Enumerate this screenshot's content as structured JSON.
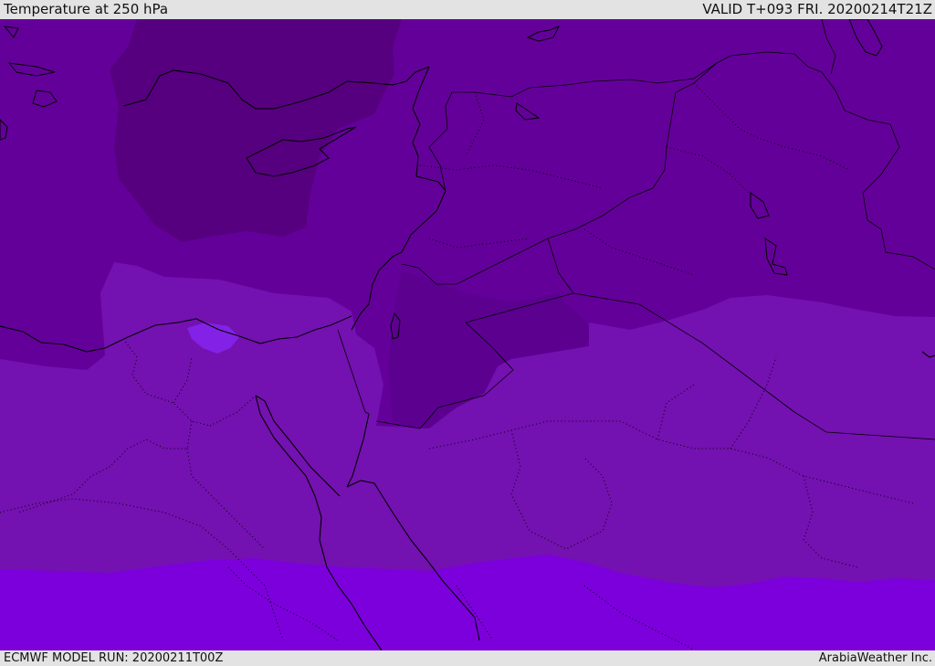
{
  "header": {
    "title": "Temperature at 250 hPa",
    "valid": "VALID T+093 FRI. 20200214T21Z"
  },
  "footer": {
    "model_run": "ECMWF MODEL RUN: 20200211T00Z",
    "credit": "ArabiaWeather Inc."
  },
  "colors": {
    "band_coldest": "#56007f",
    "band_cold": "#64009a",
    "band_mid": "#7411b1",
    "band_warm": "#7c00dc",
    "band_pocket": "#8322e6",
    "bar_background": "#e3e3e3"
  }
}
